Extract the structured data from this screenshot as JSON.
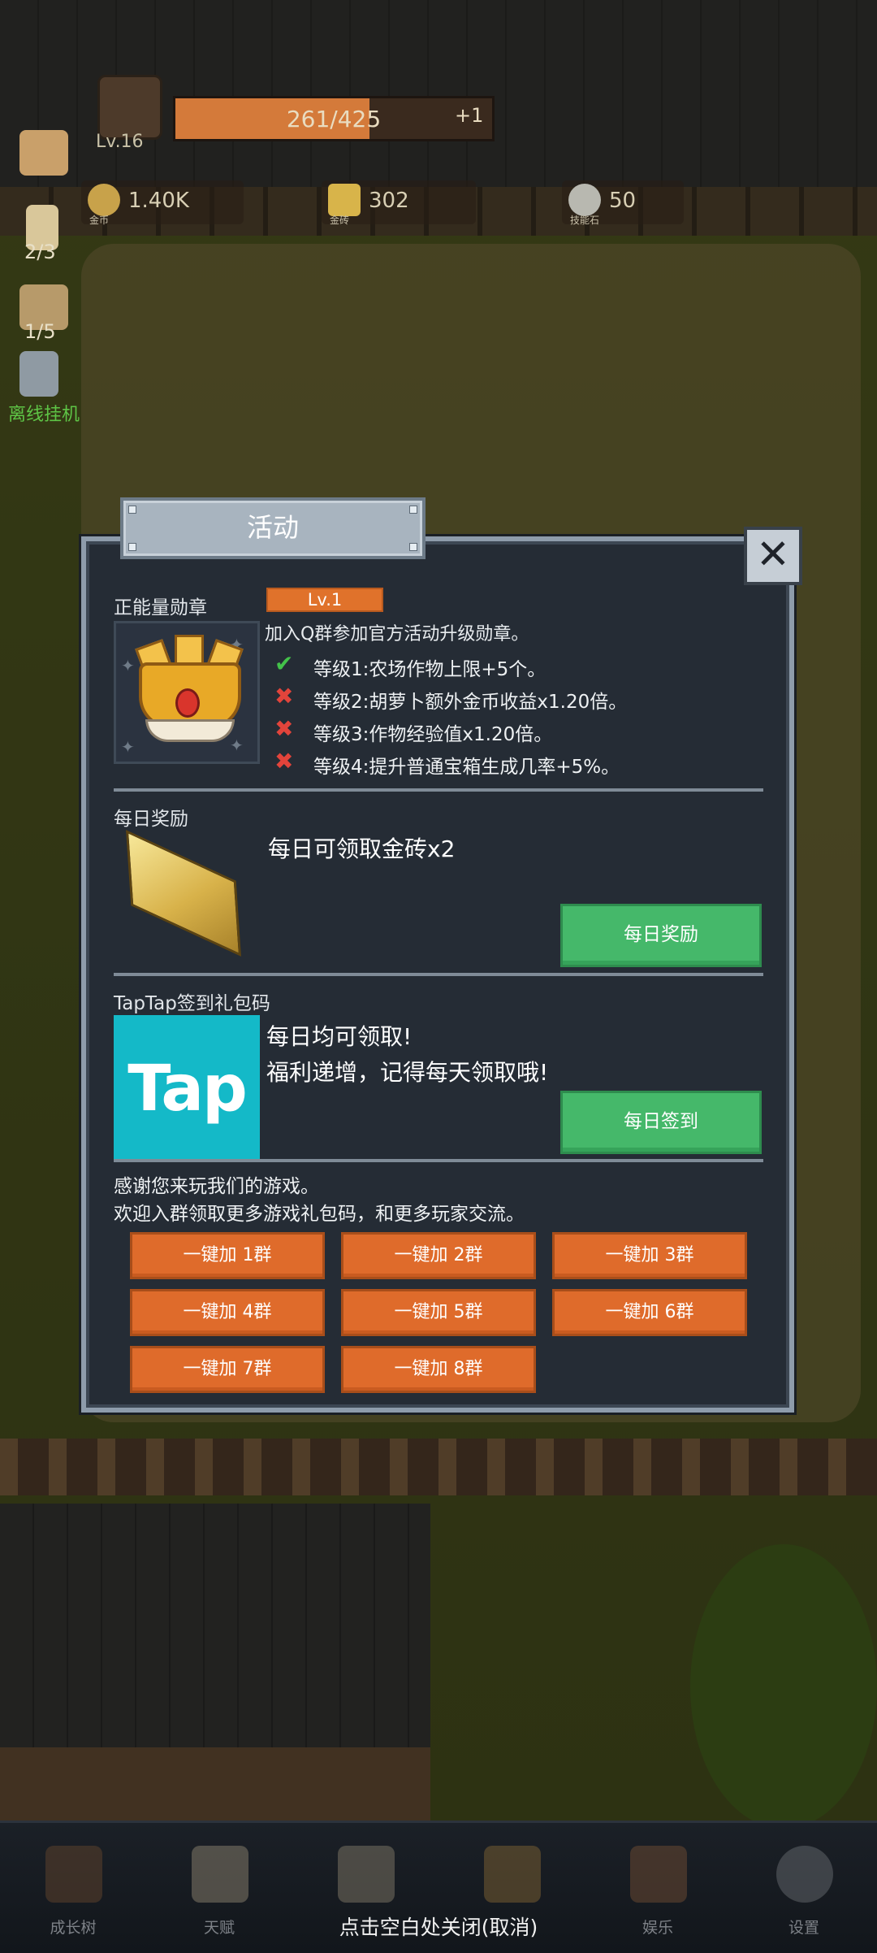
{
  "hud": {
    "level": "Lv.16",
    "exp_text": "261/425",
    "exp_progress": 0.614,
    "exp_bonus": "+1",
    "currencies": [
      {
        "value": "1.40K",
        "label": "金币",
        "icon": "coin-icon"
      },
      {
        "value": "302",
        "label": "金砖",
        "icon": "gold-brick-icon"
      },
      {
        "value": "50",
        "label": "技能石",
        "icon": "skill-stone-icon"
      }
    ],
    "side": [
      {
        "text": "2/3",
        "icon": "candle-icon"
      },
      {
        "text": "1/5",
        "icon": "beer-icon"
      }
    ],
    "idle_label": "离线挂机"
  },
  "dialog": {
    "title": "活动",
    "close_icon": "close-x-icon",
    "medal": {
      "section_title": "正能量勋章",
      "level_badge": "Lv.1",
      "intro": "加入Q群参加官方活动升级勋章。",
      "levels": [
        {
          "text": "等级1:农场作物上限+5个。",
          "unlocked": true
        },
        {
          "text": "等级2:胡萝卜额外金币收益x1.20倍。",
          "unlocked": false
        },
        {
          "text": "等级3:作物经验值x1.20倍。",
          "unlocked": false
        },
        {
          "text": "等级4:提升普通宝箱生成几率+5%。",
          "unlocked": false
        }
      ]
    },
    "daily": {
      "section_title": "每日奖励",
      "text": "每日可领取金砖x2",
      "button": "每日奖励"
    },
    "taptap": {
      "section_title": "TapTap签到礼包码",
      "logo_text": "Tap",
      "line1": "每日均可领取!",
      "line2": "福利递增，记得每天领取哦!",
      "button": "每日签到"
    },
    "thanks": {
      "line1": "感谢您来玩我们的游戏。",
      "line2": "欢迎入群领取更多游戏礼包码，和更多玩家交流。"
    },
    "groups": [
      "一键加 1群",
      "一键加 2群",
      "一键加 3群",
      "一键加 4群",
      "一键加 5群",
      "一键加 6群",
      "一键加 7群",
      "一键加 8群"
    ]
  },
  "bottom_nav": [
    {
      "label": "成长树",
      "icon": "book-icon"
    },
    {
      "label": "天赋",
      "icon": "scroll-icon"
    },
    {
      "label": "",
      "icon": "map-icon"
    },
    {
      "label": "",
      "icon": "key-icon"
    },
    {
      "label": "娱乐",
      "icon": "horn-icon"
    },
    {
      "label": "设置",
      "icon": "gear-icon"
    }
  ],
  "close_hint": "点击空白处关闭(取消)",
  "colors": {
    "panel_bg": "#252c35",
    "orange_button": "#df6b2b",
    "green_button": "#45b86a",
    "taptap_brand": "#14b9c8",
    "check_green": "#43c24a",
    "cross_red": "#e2443b"
  }
}
